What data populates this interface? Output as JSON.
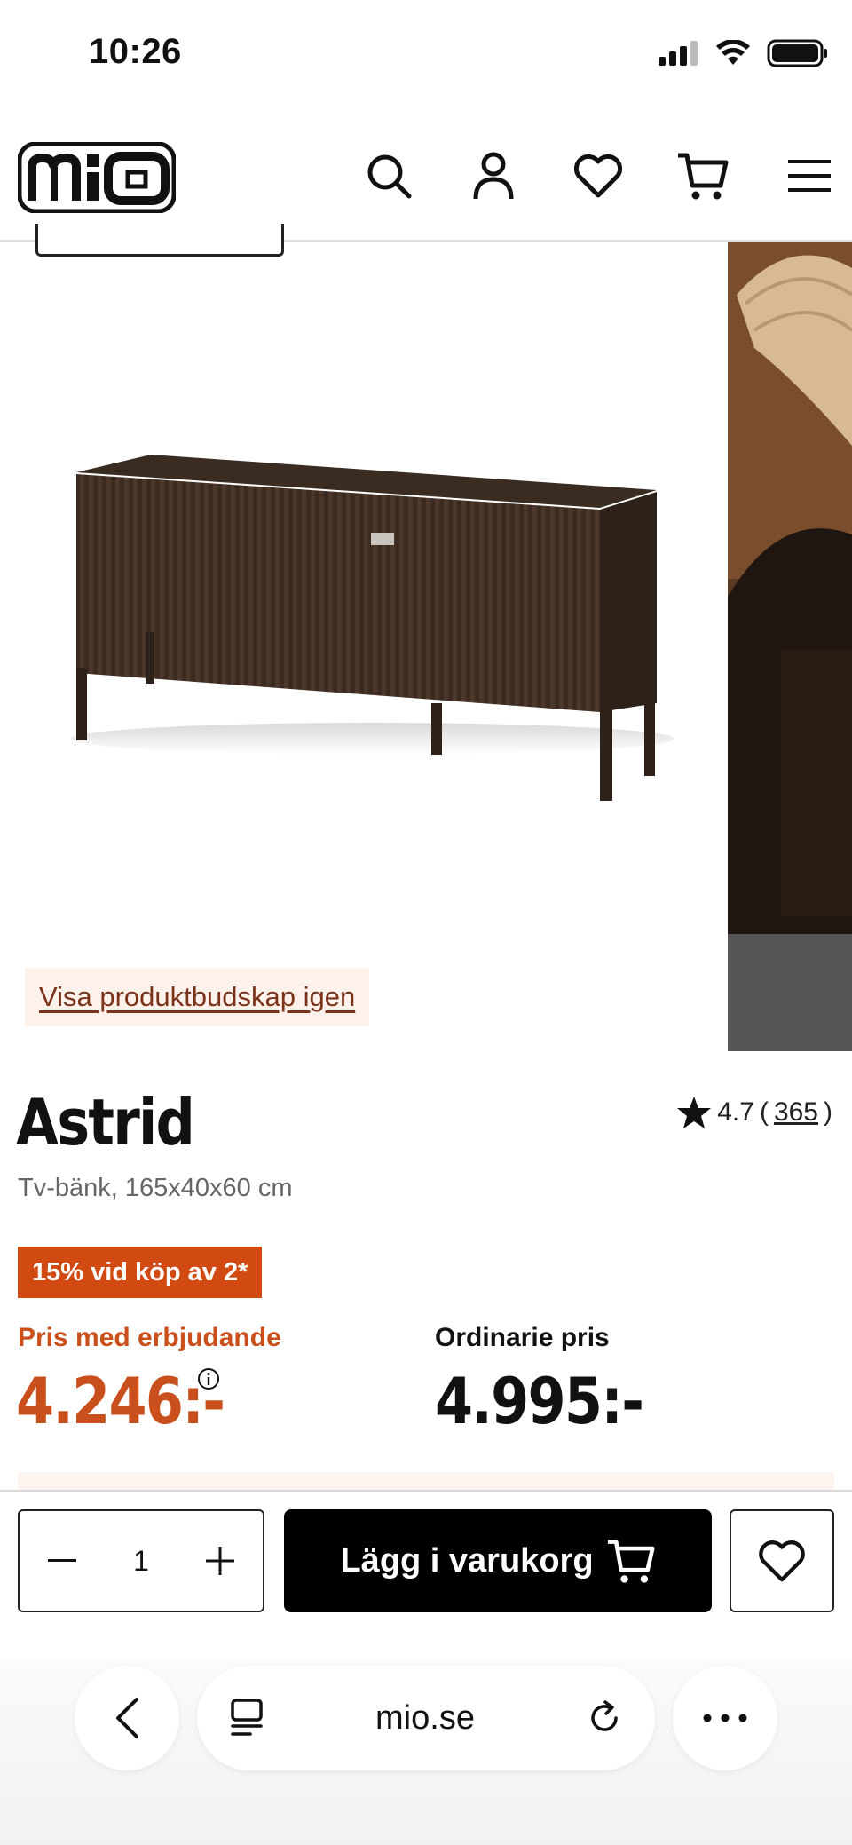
{
  "status_bar": {
    "time": "10:26"
  },
  "header": {
    "logo_text": "mio",
    "icons": [
      "search-icon",
      "account-icon",
      "heart-icon",
      "cart-icon",
      "menu-icon"
    ]
  },
  "gallery": {
    "message_link": "Visa produktbudskap igen"
  },
  "product": {
    "name": "Astrid",
    "description": "Tv-bänk, 165x40x60 cm",
    "rating": "4.7",
    "review_count": "365",
    "rating_open": "(",
    "rating_close": ")",
    "promo_badge": "15% vid köp av 2*",
    "offer_label": "Pris med erbjudande",
    "offer_price": "4.246:-",
    "regular_label": "Ordinarie pris",
    "regular_price": "4.995:-"
  },
  "buy_bar": {
    "quantity": "1",
    "add_to_cart_label": "Lägg i varukorg"
  },
  "browser": {
    "url": "mio.se"
  },
  "colors": {
    "accent_orange": "#c9501c",
    "promo_bg": "#d14a12",
    "primary_button": "#000000"
  }
}
